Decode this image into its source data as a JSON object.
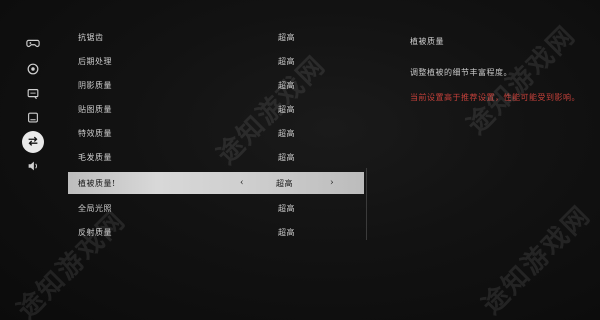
{
  "sidebar": {
    "items": [
      {
        "icon": "gamepad-icon"
      },
      {
        "icon": "display-icon"
      },
      {
        "icon": "chat-icon"
      },
      {
        "icon": "monitor-icon"
      },
      {
        "icon": "swap-icon",
        "active": true
      },
      {
        "icon": "audio-icon"
      }
    ]
  },
  "settings": {
    "rows": [
      {
        "label": "抗锯齿",
        "value": "超高"
      },
      {
        "label": "后期处理",
        "value": "超高"
      },
      {
        "label": "阴影质量",
        "value": "超高"
      },
      {
        "label": "贴图质量",
        "value": "超高"
      },
      {
        "label": "特效质量",
        "value": "超高"
      },
      {
        "label": "毛发质量",
        "value": "超高"
      },
      {
        "label": "植被质量!",
        "value": "超高",
        "selected": true
      },
      {
        "label": "全局光照",
        "value": "超高"
      },
      {
        "label": "反射质量",
        "value": "超高"
      }
    ],
    "arrow_left": "‹",
    "arrow_right": "›"
  },
  "description": {
    "title": "植被质量",
    "text": "调整植被的细节丰富程度。",
    "warning": "当前设置高于推荐设置，性能可能受到影响。"
  },
  "watermark": {
    "text": "途知游戏网"
  }
}
